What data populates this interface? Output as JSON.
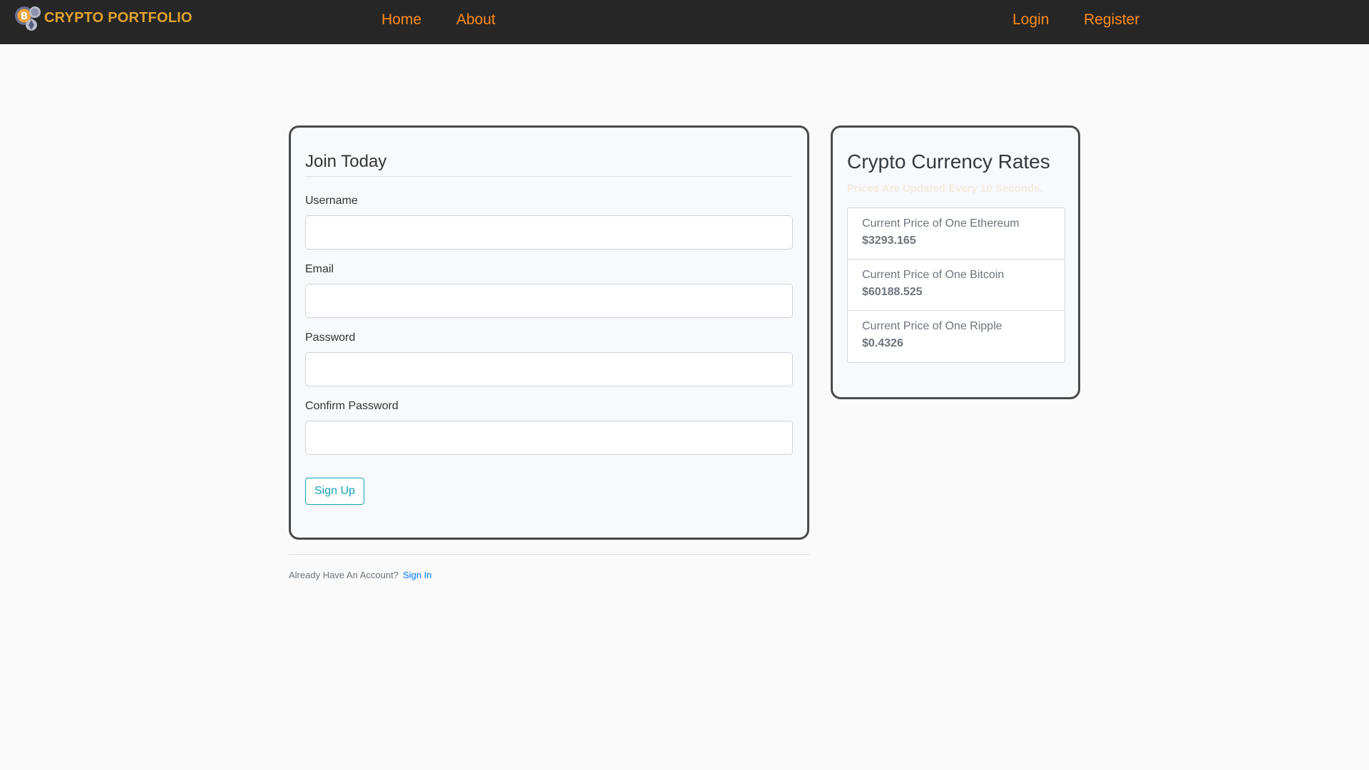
{
  "navbar": {
    "brand": "CRYPTO PORTFOLIO",
    "brand_logo": "crypto-coins-icon",
    "links": {
      "home": "Home",
      "about": "About",
      "login": "Login",
      "register": "Register"
    },
    "colors": {
      "background": "#262626",
      "brand": "#e0a22e",
      "link": "#ff8c1a"
    }
  },
  "form": {
    "legend": "Join Today",
    "username_label": "Username",
    "email_label": "Email",
    "password_label": "Password",
    "confirm_label": "Confirm Password",
    "username_value": "",
    "email_value": "",
    "password_value": "",
    "confirm_value": "",
    "submit_label": "Sign Up"
  },
  "footer": {
    "text": "Already Have An Account?",
    "link": "Sign In"
  },
  "rates": {
    "title": "Crypto Currency Rates",
    "subtitle": "Prices Are Updated Every 10 Seconds.",
    "items": [
      {
        "name": "Current Price of One Ethereum",
        "value": "$3293.165"
      },
      {
        "name": "Current Price of One Bitcoin",
        "value": "$60188.525"
      },
      {
        "name": "Current Price of One Ripple",
        "value": "$0.4326"
      }
    ]
  }
}
